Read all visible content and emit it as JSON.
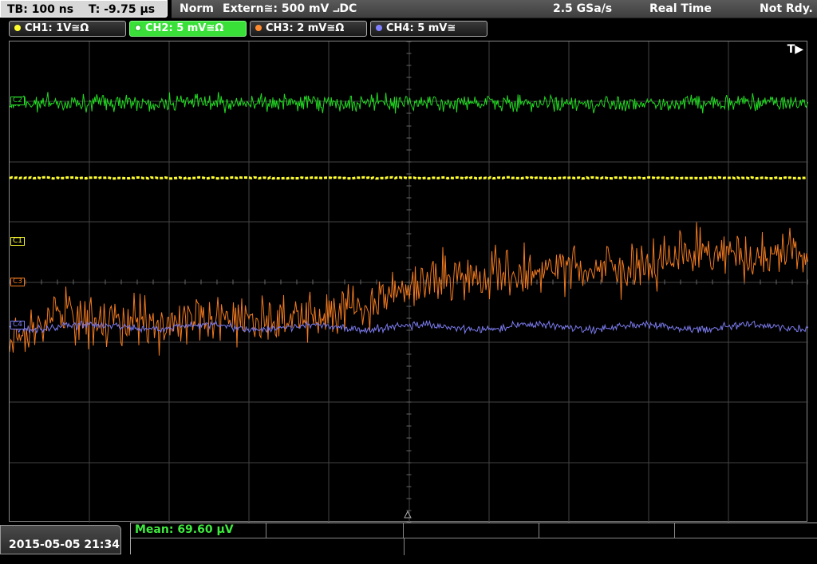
{
  "top": {
    "timebase": "TB: 100 ns",
    "trigger_time": "T: -9.75 µs",
    "mode": "Norm",
    "trigger_source": "Extern≅: 500 mV ⨼DC",
    "sample_rate": "2.5 GSa/s",
    "acq_mode": "Real Time",
    "status": "Not Rdy."
  },
  "channels": [
    {
      "label": "CH1: 1V≅Ω",
      "color": "#ffff40",
      "active": false
    },
    {
      "label": "CH2: 5 mV≅Ω",
      "color": "#2ad82a",
      "active": true
    },
    {
      "label": "CH3: 2 mV≅Ω",
      "color": "#ff8a30",
      "active": false
    },
    {
      "label": "CH4: 5 mV≅",
      "color": "#8080ff",
      "active": false
    }
  ],
  "markers": {
    "c1": "C1",
    "c2": "C2",
    "c3": "C3",
    "c4": "C4",
    "trigger": "T▶"
  },
  "bottom": {
    "datetime": "2015-05-05 21:34",
    "mean": "Mean: 69.60 µV"
  },
  "colors": {
    "ch1": "#ffff30",
    "ch2": "#22d822",
    "ch3": "#f07a20",
    "ch4": "#7a7aee",
    "grid": "#444444"
  }
}
